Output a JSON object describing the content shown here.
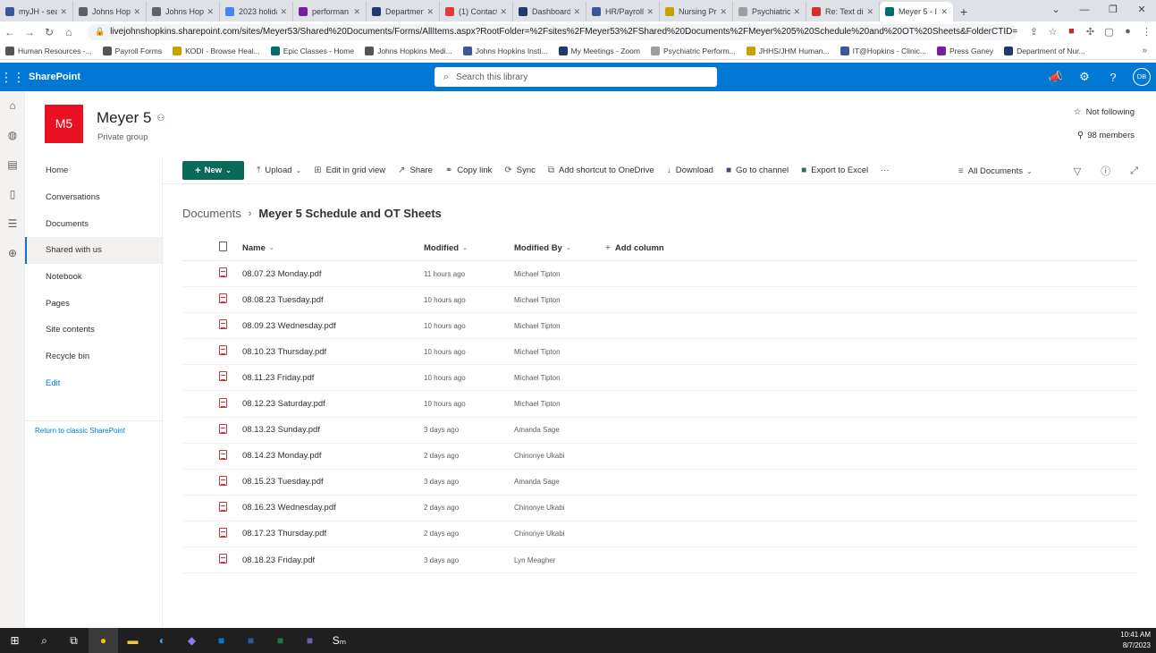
{
  "browser": {
    "tabs": [
      {
        "title": "myJH - sea",
        "color": "#3b5998"
      },
      {
        "title": "Johns Hopk",
        "color": "#5f6368"
      },
      {
        "title": "Johns Hopk",
        "color": "#5f6368"
      },
      {
        "title": "2023 holida",
        "color": "#4285f4"
      },
      {
        "title": "performan",
        "color": "#7b1fa2"
      },
      {
        "title": "Departmen",
        "color": "#1e3a6e"
      },
      {
        "title": "(1) Contact",
        "color": "#e53935"
      },
      {
        "title": "Dashboard",
        "color": "#1e3a6e"
      },
      {
        "title": "HR/Payroll",
        "color": "#3b5998"
      },
      {
        "title": "Nursing Pr",
        "color": "#c8a000"
      },
      {
        "title": "Psychiatric",
        "color": "#9e9e9e"
      },
      {
        "title": "Re: Text dis",
        "color": "#d32f2f"
      },
      {
        "title": "Meyer 5 - I",
        "color": "#036c70"
      }
    ],
    "close_glyph": "✕",
    "new_tab": "+",
    "url": "livejohnshopkins.sharepoint.com/sites/Meyer53/Shared%20Documents/Forms/AllItems.aspx?RootFolder=%2Fsites%2FMeyer53%2FShared%20Documents%2FMeyer%205%20Schedule%20and%20OT%20Sheets&FolderCTID=0x012000014888...",
    "bookmarks": [
      {
        "label": "Human Resources -...",
        "color": "#555"
      },
      {
        "label": "Payroll Forms",
        "color": "#555"
      },
      {
        "label": "KODI - Browse Heal...",
        "color": "#c8a000"
      },
      {
        "label": "Epic Classes - Home",
        "color": "#036c70"
      },
      {
        "label": "Johns Hopkins Medi...",
        "color": "#555"
      },
      {
        "label": "Johns Hopkins Insti...",
        "color": "#3b5998"
      },
      {
        "label": "My Meetings - Zoom",
        "color": "#1e3a6e"
      },
      {
        "label": "Psychiatric Perform...",
        "color": "#9e9e9e"
      },
      {
        "label": "JHHS/JHM Human...",
        "color": "#c8a000"
      },
      {
        "label": "IT@Hopkins - Clinic...",
        "color": "#3b5998"
      },
      {
        "label": "Press Ganey",
        "color": "#7b1fa2"
      },
      {
        "label": "Department of Nur...",
        "color": "#1e3a6e"
      }
    ]
  },
  "suite": {
    "brand": "SharePoint",
    "search_placeholder": "Search this library",
    "avatar": "DB",
    "accent": "#0078d4"
  },
  "site": {
    "logo": "M5",
    "title": "Meyer 5",
    "subtitle": "Private group",
    "follow": "Not following",
    "members": "98 members"
  },
  "nav": {
    "items": [
      "Home",
      "Conversations",
      "Documents",
      "Shared with us",
      "Notebook",
      "Pages",
      "Site contents",
      "Recycle bin"
    ],
    "selected_index": 3,
    "edit": "Edit",
    "classic": "Return to classic SharePoint"
  },
  "commands": {
    "new": "New",
    "upload": "Upload",
    "edit_grid": "Edit in grid view",
    "share": "Share",
    "copy_link": "Copy link",
    "sync": "Sync",
    "add_shortcut": "Add shortcut to OneDrive",
    "download": "Download",
    "go_channel": "Go to channel",
    "export_excel": "Export to Excel",
    "more": "···",
    "view": "All Documents"
  },
  "breadcrumb": {
    "root": "Documents",
    "current": "Meyer 5 Schedule and OT Sheets"
  },
  "table": {
    "headers": {
      "name": "Name",
      "modified": "Modified",
      "modified_by": "Modified By",
      "add_column": "Add column"
    },
    "rows": [
      {
        "name": "08.07.23 Monday.pdf",
        "modified": "11 hours ago",
        "by": "Michael Tipton"
      },
      {
        "name": "08.08.23 Tuesday.pdf",
        "modified": "10 hours ago",
        "by": "Michael Tipton"
      },
      {
        "name": "08.09.23 Wednesday.pdf",
        "modified": "10 hours ago",
        "by": "Michael Tipton"
      },
      {
        "name": "08.10.23 Thursday.pdf",
        "modified": "10 hours ago",
        "by": "Michael Tipton"
      },
      {
        "name": "08.11.23 Friday.pdf",
        "modified": "10 hours ago",
        "by": "Michael Tipton"
      },
      {
        "name": "08.12.23 Saturday.pdf",
        "modified": "10 hours ago",
        "by": "Michael Tipton"
      },
      {
        "name": "08.13.23 Sunday.pdf",
        "modified": "3 days ago",
        "by": "Amanda Sage"
      },
      {
        "name": "08.14.23 Monday.pdf",
        "modified": "2 days ago",
        "by": "Chinonye Ukabi"
      },
      {
        "name": "08.15.23 Tuesday.pdf",
        "modified": "3 days ago",
        "by": "Amanda Sage"
      },
      {
        "name": "08.16.23 Wednesday.pdf",
        "modified": "2 days ago",
        "by": "Chinonye Ukabi"
      },
      {
        "name": "08.17.23 Thursday.pdf",
        "modified": "2 days ago",
        "by": "Chinonye Ukabi"
      },
      {
        "name": "08.18.23 Friday.pdf",
        "modified": "3 days ago",
        "by": "Lyn Meagher"
      }
    ]
  },
  "taskbar": {
    "time": "10:41 AM",
    "date": "8/7/2023"
  }
}
